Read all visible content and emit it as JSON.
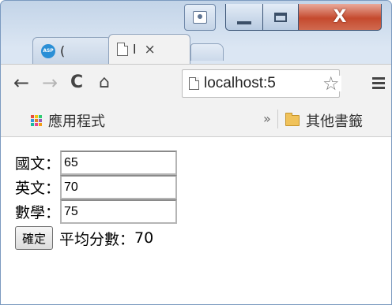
{
  "window": {
    "caption": {
      "close_glyph": "X"
    }
  },
  "tabs": [
    {
      "label": "(",
      "icon": "asp-icon"
    },
    {
      "label": "l",
      "icon": "page-icon",
      "close": "×"
    }
  ],
  "toolbar": {
    "back": "←",
    "forward": "→",
    "reload": "C",
    "home": "⌂",
    "address": "localhost:5",
    "star": "☆"
  },
  "bookmarks": {
    "apps_label": "應用程式",
    "overflow": "»",
    "other_label": "其他書籤"
  },
  "form": {
    "chinese_label": "國文：",
    "chinese_value": "65",
    "english_label": "英文：",
    "english_value": "70",
    "math_label": "數學：",
    "math_value": "75",
    "submit_label": "確定",
    "result_label": "平均分數：",
    "result_value": "70"
  },
  "colors": {
    "apps_grid": [
      "#e74c3c",
      "#f1c40f",
      "#2ecc71",
      "#3498db",
      "#e67e22",
      "#9b59b6",
      "#1abc9c",
      "#e84393",
      "#f39c12"
    ]
  }
}
